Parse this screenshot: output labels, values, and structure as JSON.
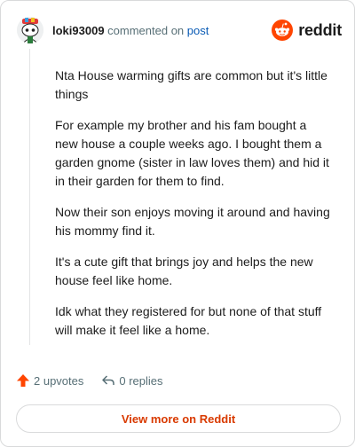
{
  "header": {
    "username": "loki93009",
    "action_text": "commented on",
    "post_link": "post",
    "brand": "reddit"
  },
  "comment": {
    "paragraphs": [
      "Nta House warming gifts are common but it's little things",
      "For example my brother and his fam bought a new house a couple weeks ago. I bought them a garden gnome (sister in law loves them) and hid it in their garden for them to find.",
      "Now their son enjoys moving it around and having his mommy find it.",
      "It's a cute gift that brings joy and helps the new house feel like home.",
      "Idk what they registered for but none of that stuff will make it feel like a home."
    ]
  },
  "actions": {
    "upvotes": "2 upvotes",
    "replies": "0 replies"
  },
  "footer": {
    "view_more": "View more on Reddit"
  },
  "colors": {
    "accent": "#d93a00",
    "upvote": "#ff4500",
    "link": "#0a5bb5",
    "muted": "#576f76"
  },
  "icons": {
    "avatar": "snoo-avatar",
    "brand": "reddit-logo-icon",
    "upvote": "upvote-arrow-icon",
    "reply": "reply-arrow-icon"
  }
}
